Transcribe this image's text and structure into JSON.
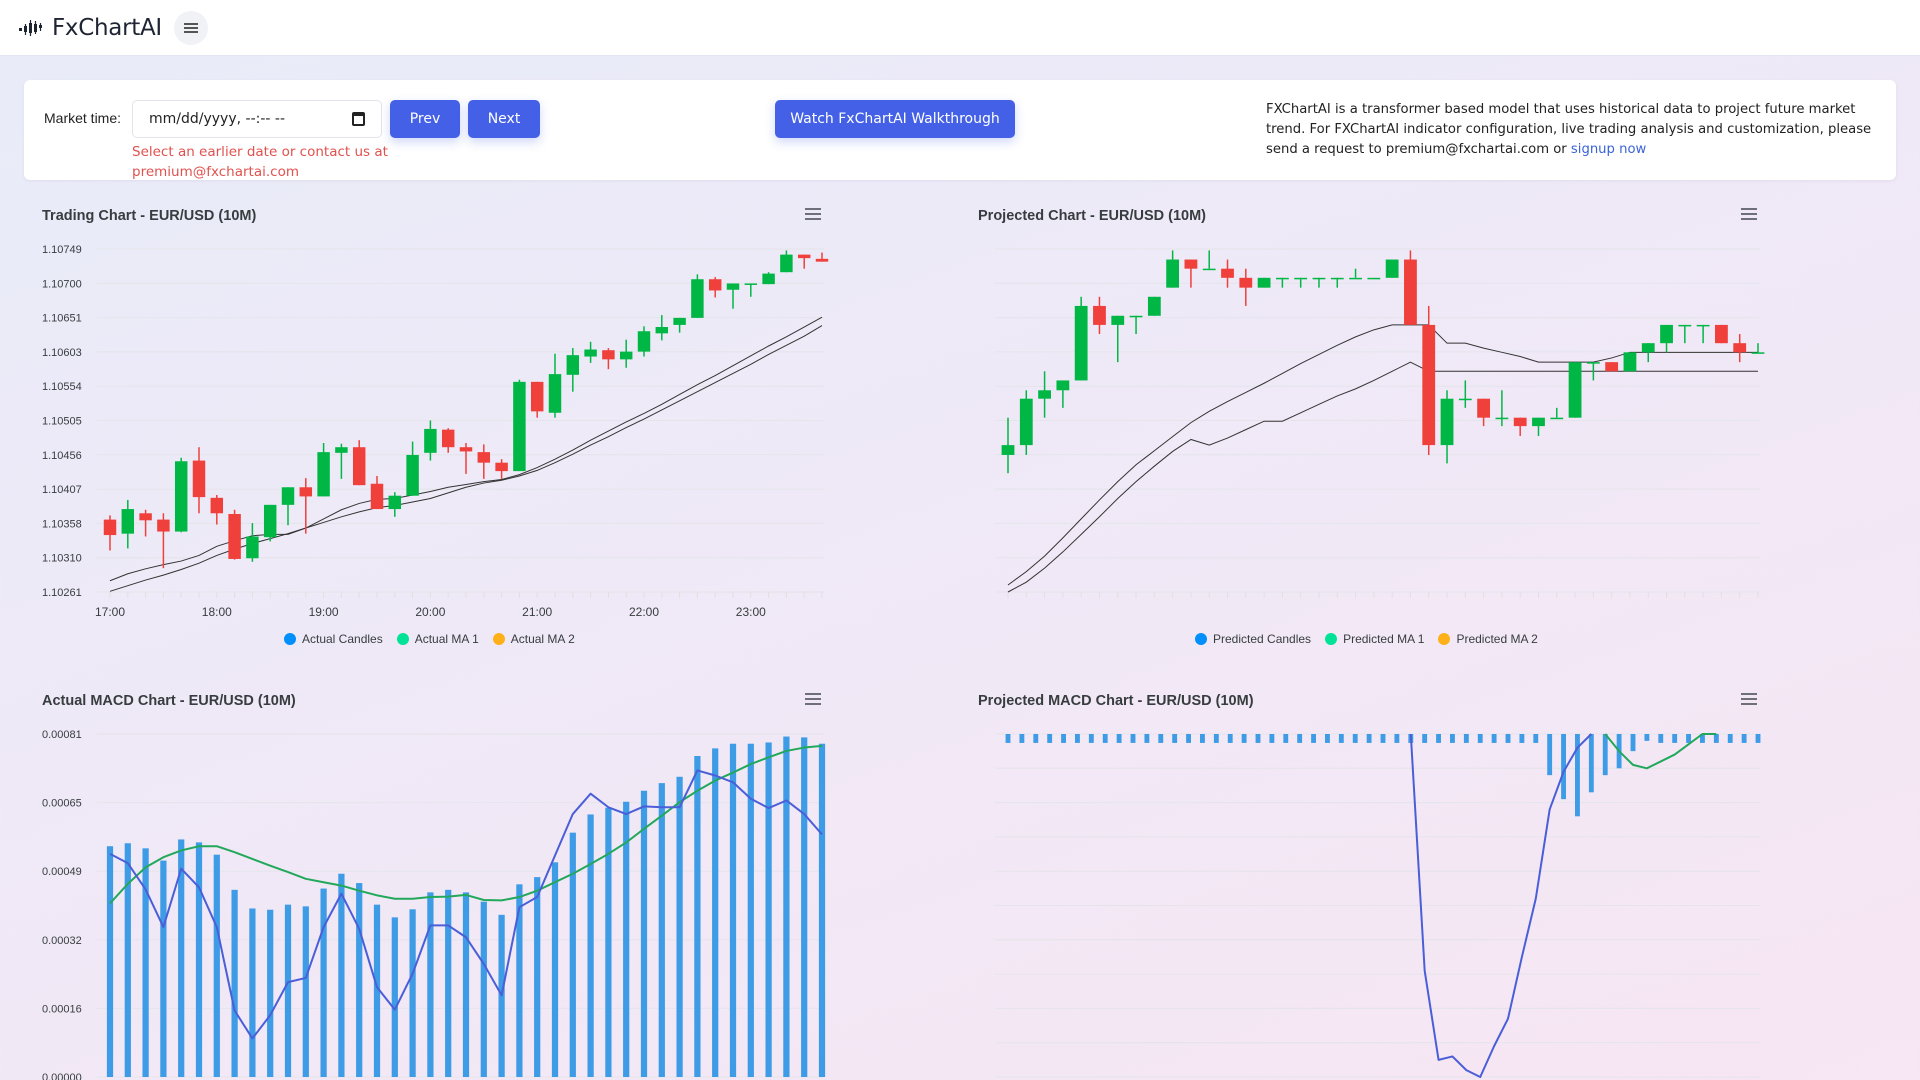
{
  "header": {
    "brand_name": "FxChartAI",
    "logo_icon": "candlestick-logo-icon",
    "menu_icon": "hamburger-menu-icon"
  },
  "controls": {
    "market_time_label": "Market time:",
    "market_time_value": "",
    "market_time_placeholder": "mm/dd/yyyy, --:-- --",
    "calendar_icon": "calendar-icon",
    "prev_label": "Prev",
    "next_label": "Next",
    "warning_line1": "Select an earlier date or contact us at",
    "warning_line2": "premium@fxchartai.com",
    "walkthrough_label": "Watch FxChartAI Walkthrough",
    "about_text": "FXChartAI is a transformer based model that uses historical data to project future market trend. For FXChartAI indicator configuration, live trading analysis and customization, please send a request to premium@fxchartai.com or ",
    "signup_link": "signup now"
  },
  "colors": {
    "accent": "#4460e6",
    "bull": "#00b746",
    "bear": "#ef403c",
    "macd_bar": "#3e9be6",
    "macd_line": "#4a5ed8",
    "signal_line": "#22a85a",
    "ma_line": "#333333",
    "warning": "#e0524f",
    "legend_candles": "#008ffb",
    "legend_ma1": "#00e396",
    "legend_ma2": "#feb019"
  },
  "chart_data": [
    {
      "id": "trading",
      "type": "candlestick",
      "title": "Trading Chart - EUR/USD (10M)",
      "menu_icon": "chart-menu-icon",
      "ylim": [
        1.10261,
        1.10749
      ],
      "yticks": [
        "1.10749",
        "1.10700",
        "1.10651",
        "1.10603",
        "1.10554",
        "1.10505",
        "1.10456",
        "1.10407",
        "1.10358",
        "1.10310",
        "1.10261"
      ],
      "xticks": [
        "17:00",
        "18:00",
        "19:00",
        "20:00",
        "21:00",
        "22:00",
        "23:00"
      ],
      "x_start": "17:00",
      "interval_minutes": 10,
      "legend": [
        "Actual Candles",
        "Actual MA 1",
        "Actual MA 2"
      ],
      "legend_position": "bottom-center",
      "grid": true,
      "candles": [
        [
          1.10364,
          1.1037,
          1.1032,
          1.10342
        ],
        [
          1.10344,
          1.10392,
          1.10323,
          1.10379
        ],
        [
          1.10373,
          1.10378,
          1.1034,
          1.10363
        ],
        [
          1.10364,
          1.10373,
          1.10295,
          1.10347
        ],
        [
          1.10347,
          1.10452,
          1.10346,
          1.10447
        ],
        [
          1.10448,
          1.10467,
          1.10373,
          1.10396
        ],
        [
          1.10395,
          1.10399,
          1.10357,
          1.10373
        ],
        [
          1.10372,
          1.10378,
          1.10307,
          1.10308
        ],
        [
          1.10309,
          1.10359,
          1.10304,
          1.1034
        ],
        [
          1.10339,
          1.10385,
          1.10333,
          1.10385
        ],
        [
          1.10385,
          1.1041,
          1.10356,
          1.1041
        ],
        [
          1.1041,
          1.10423,
          1.10344,
          1.10397
        ],
        [
          1.10397,
          1.10473,
          1.10397,
          1.1046
        ],
        [
          1.10459,
          1.10472,
          1.10422,
          1.10467
        ],
        [
          1.10467,
          1.10477,
          1.10413,
          1.10413
        ],
        [
          1.10415,
          1.10426,
          1.10379,
          1.10379
        ],
        [
          1.10379,
          1.10403,
          1.10368,
          1.10398
        ],
        [
          1.10398,
          1.10475,
          1.10398,
          1.10456
        ],
        [
          1.10459,
          1.10505,
          1.10448,
          1.10493
        ],
        [
          1.10492,
          1.10494,
          1.10459,
          1.10467
        ],
        [
          1.10467,
          1.10473,
          1.10429,
          1.10461
        ],
        [
          1.1046,
          1.10471,
          1.10422,
          1.10445
        ],
        [
          1.10445,
          1.1045,
          1.10422,
          1.10433
        ],
        [
          1.10433,
          1.10563,
          1.10433,
          1.1056
        ],
        [
          1.1056,
          1.1056,
          1.10509,
          1.10518
        ],
        [
          1.10516,
          1.106,
          1.10509,
          1.10571
        ],
        [
          1.1057,
          1.10608,
          1.10546,
          1.10598
        ],
        [
          1.10596,
          1.10617,
          1.10587,
          1.10606
        ],
        [
          1.10605,
          1.10608,
          1.10578,
          1.10592
        ],
        [
          1.10592,
          1.1062,
          1.1058,
          1.10603
        ],
        [
          1.10603,
          1.10639,
          1.10596,
          1.10632
        ],
        [
          1.10629,
          1.10655,
          1.10619,
          1.10638
        ],
        [
          1.10641,
          1.10651,
          1.1063,
          1.10651
        ],
        [
          1.10651,
          1.10713,
          1.10651,
          1.10706
        ],
        [
          1.10706,
          1.10709,
          1.1068,
          1.1069
        ],
        [
          1.10691,
          1.107,
          1.10664,
          1.107
        ],
        [
          1.10699,
          1.107,
          1.10681,
          1.107
        ],
        [
          1.10699,
          1.10716,
          1.10699,
          1.10714
        ],
        [
          1.10716,
          1.10747,
          1.10716,
          1.10741
        ],
        [
          1.10741,
          1.10741,
          1.10721,
          1.10736
        ],
        [
          1.10735,
          1.10744,
          1.10731,
          1.10731
        ]
      ],
      "ma1": [
        1.10277,
        1.10287,
        1.10294,
        1.103,
        1.10305,
        1.10313,
        1.10326,
        1.10334,
        1.10341,
        1.10343,
        1.10343,
        1.10352,
        1.10365,
        1.10378,
        1.10387,
        1.10393,
        1.10394,
        1.10399,
        1.10404,
        1.1041,
        1.10414,
        1.10418,
        1.10421,
        1.10428,
        1.10438,
        1.1045,
        1.10463,
        1.10477,
        1.1049,
        1.10503,
        1.10515,
        1.10528,
        1.10542,
        1.10556,
        1.10569,
        1.10583,
        1.10597,
        1.10611,
        1.10624,
        1.10638,
        1.10652
      ],
      "ma2": [
        1.10262,
        1.1027,
        1.10278,
        1.10285,
        1.10293,
        1.10302,
        1.10313,
        1.10322,
        1.1033,
        1.10337,
        1.10344,
        1.10352,
        1.1036,
        1.10368,
        1.10375,
        1.10381,
        1.10384,
        1.10389,
        1.10394,
        1.10402,
        1.1041,
        1.10416,
        1.1042,
        1.10426,
        1.10434,
        1.10445,
        1.10457,
        1.1047,
        1.10482,
        1.10495,
        1.10507,
        1.1052,
        1.10533,
        1.10546,
        1.10559,
        1.10572,
        1.10585,
        1.10599,
        1.10612,
        1.10625,
        1.1064
      ]
    },
    {
      "id": "projected",
      "type": "candlestick",
      "title": "Projected Chart - EUR/USD (10M)",
      "menu_icon": "chart-menu-icon",
      "ylim": [
        1.10261,
        1.10749
      ],
      "yticks": [],
      "xticks": [],
      "legend": [
        "Predicted Candles",
        "Predicted MA 1",
        "Predicted MA 2"
      ],
      "legend_position": "bottom-center",
      "grid": true,
      "candles": [
        [
          1.10456,
          1.10509,
          1.1043,
          1.1047
        ],
        [
          1.1047,
          1.10548,
          1.10456,
          1.10536
        ],
        [
          1.10536,
          1.10575,
          1.10509,
          1.10548
        ],
        [
          1.10548,
          1.10562,
          1.10523,
          1.10562
        ],
        [
          1.10562,
          1.10681,
          1.10562,
          1.10668
        ],
        [
          1.10668,
          1.10681,
          1.10628,
          1.10641
        ],
        [
          1.10641,
          1.10654,
          1.10588,
          1.10654
        ],
        [
          1.10654,
          1.10654,
          1.10628,
          1.10654
        ],
        [
          1.10654,
          1.10681,
          1.10654,
          1.10681
        ],
        [
          1.10694,
          1.10747,
          1.10694,
          1.10734
        ],
        [
          1.10734,
          1.10734,
          1.10694,
          1.10721
        ],
        [
          1.10721,
          1.10747,
          1.10721,
          1.10721
        ],
        [
          1.10721,
          1.10734,
          1.10694,
          1.10708
        ],
        [
          1.10708,
          1.10721,
          1.10668,
          1.10694
        ],
        [
          1.10694,
          1.10708,
          1.10694,
          1.10708
        ],
        [
          1.10708,
          1.10708,
          1.10694,
          1.10708
        ],
        [
          1.10708,
          1.10708,
          1.10694,
          1.10708
        ],
        [
          1.10708,
          1.10708,
          1.10694,
          1.10708
        ],
        [
          1.10708,
          1.10708,
          1.10694,
          1.10708
        ],
        [
          1.10708,
          1.10721,
          1.10708,
          1.10708
        ],
        [
          1.10708,
          1.10708,
          1.10708,
          1.10708
        ],
        [
          1.10708,
          1.10734,
          1.10708,
          1.10734
        ],
        [
          1.10734,
          1.10747,
          1.10641,
          1.10641
        ],
        [
          1.10641,
          1.10668,
          1.10456,
          1.1047
        ],
        [
          1.1047,
          1.10548,
          1.10444,
          1.10536
        ],
        [
          1.10536,
          1.10562,
          1.10523,
          1.10536
        ],
        [
          1.10536,
          1.10536,
          1.10497,
          1.10509
        ],
        [
          1.10509,
          1.10548,
          1.10497,
          1.10509
        ],
        [
          1.10509,
          1.10509,
          1.10483,
          1.10497
        ],
        [
          1.10497,
          1.10509,
          1.10483,
          1.10509
        ],
        [
          1.10509,
          1.10523,
          1.10509,
          1.10509
        ],
        [
          1.10509,
          1.10588,
          1.10509,
          1.10588
        ],
        [
          1.10588,
          1.10588,
          1.10562,
          1.10588
        ],
        [
          1.10588,
          1.10588,
          1.10575,
          1.10575
        ],
        [
          1.10575,
          1.10602,
          1.10575,
          1.10602
        ],
        [
          1.10602,
          1.10615,
          1.10588,
          1.10615
        ],
        [
          1.10615,
          1.10641,
          1.10602,
          1.10641
        ],
        [
          1.10641,
          1.10641,
          1.10615,
          1.10641
        ],
        [
          1.10641,
          1.10641,
          1.10615,
          1.10641
        ],
        [
          1.10641,
          1.10641,
          1.10615,
          1.10615
        ],
        [
          1.10615,
          1.10628,
          1.10588,
          1.10602
        ],
        [
          1.10602,
          1.10615,
          1.10602,
          1.10602
        ]
      ],
      "ma1": [
        1.10271,
        1.1029,
        1.10312,
        1.10338,
        1.10365,
        1.10392,
        1.10418,
        1.10442,
        1.10462,
        1.10482,
        1.10502,
        1.10518,
        1.10532,
        1.10545,
        1.10558,
        1.10572,
        1.10586,
        1.10599,
        1.10612,
        1.10624,
        1.10634,
        1.10641,
        1.10641,
        1.10641,
        1.10615,
        1.10615,
        1.10608,
        1.10602,
        1.10596,
        1.10588,
        1.10588,
        1.10588,
        1.10588,
        1.10594,
        1.10602,
        1.10602,
        1.10602,
        1.10602,
        1.10602,
        1.10602,
        1.10602,
        1.10602
      ],
      "ma2": [
        1.10261,
        1.10275,
        1.10295,
        1.10318,
        1.10343,
        1.10368,
        1.10394,
        1.10418,
        1.1044,
        1.10461,
        1.10478,
        1.1047,
        1.1048,
        1.10492,
        1.10504,
        1.10504,
        1.10516,
        1.10528,
        1.1054,
        1.1055,
        1.10562,
        1.10575,
        1.10588,
        1.10575,
        1.10575,
        1.10575,
        1.10575,
        1.10575,
        1.10575,
        1.10575,
        1.10575,
        1.10575,
        1.10575,
        1.10575,
        1.10575,
        1.10575,
        1.10575,
        1.10575,
        1.10575,
        1.10575,
        1.10575,
        1.10575
      ]
    },
    {
      "id": "actual_macd",
      "type": "bar+line",
      "title": "Actual MACD Chart - EUR/USD (10M)",
      "menu_icon": "chart-menu-icon",
      "ylim": [
        0,
        0.00081
      ],
      "yticks": [
        "0.00081",
        "0.00065",
        "0.00049",
        "0.00032",
        "0.00016",
        "0.00000"
      ],
      "grid": true,
      "histogram": [
        0.000545,
        0.000552,
        0.00054,
        0.000511,
        0.000561,
        0.000554,
        0.000525,
        0.000442,
        0.000398,
        0.000395,
        0.000407,
        0.000403,
        0.000445,
        0.00048,
        0.000458,
        0.000407,
        0.000377,
        0.000396,
        0.000436,
        0.000442,
        0.000436,
        0.000414,
        0.000383,
        0.000455,
        0.000472,
        0.000507,
        0.000577,
        0.00062,
        0.000636,
        0.00065,
        0.000676,
        0.000694,
        0.000709,
        0.000758,
        0.000776,
        0.000787,
        0.000787,
        0.00079,
        0.000804,
        0.000802,
        0.000787
      ],
      "macd": [
        0.000527,
        0.000505,
        0.000443,
        0.000354,
        0.000492,
        0.000448,
        0.000354,
        0.000157,
        9.1e-05,
        0.000146,
        0.000224,
        0.000234,
        0.000354,
        0.000433,
        0.00035,
        0.000212,
        0.000159,
        0.000244,
        0.000358,
        0.000358,
        0.00033,
        0.000267,
        0.000193,
        0.000401,
        0.000425,
        0.000523,
        0.000621,
        0.000669,
        0.000637,
        0.000621,
        0.000639,
        0.000637,
        0.000637,
        0.000724,
        0.000712,
        0.000696,
        0.000657,
        0.000635,
        0.000653,
        0.000621,
        0.000573
      ],
      "signal": [
        0.00041,
        0.000456,
        0.000495,
        0.000519,
        0.000535,
        0.000545,
        0.000545,
        0.000531,
        0.000515,
        0.000499,
        0.000484,
        0.000468,
        0.00046,
        0.000452,
        0.00044,
        0.000429,
        0.000421,
        0.000421,
        0.000425,
        0.000426,
        0.00043,
        0.000418,
        0.000417,
        0.000425,
        0.00044,
        0.00046,
        0.00048,
        0.000503,
        0.000527,
        0.000554,
        0.000586,
        0.000617,
        0.000649,
        0.000676,
        0.0007,
        0.000719,
        0.000739,
        0.000755,
        0.00077,
        0.000778,
        0.000782
      ]
    },
    {
      "id": "projected_macd",
      "type": "bar+line",
      "title": "Projected MACD Chart - EUR/USD (10M)",
      "menu_icon": "chart-menu-icon",
      "units": "relative (gridline units, unlabeled axis)",
      "ylim": [
        -10,
        0
      ],
      "yticks": [],
      "grid": true,
      "histogram": [
        -0.26,
        -0.26,
        -0.26,
        -0.26,
        -0.26,
        -0.26,
        -0.26,
        -0.26,
        -0.26,
        -0.26,
        -0.26,
        -0.26,
        -0.26,
        -0.26,
        -0.26,
        -0.26,
        -0.26,
        -0.26,
        -0.26,
        -0.26,
        -0.26,
        -0.26,
        -0.26,
        -0.26,
        -0.26,
        -0.26,
        -0.26,
        -0.26,
        -0.26,
        -0.26,
        -0.26,
        -0.26,
        -0.26,
        -0.26,
        -0.26,
        -0.26,
        -0.26,
        -0.26,
        -0.26,
        -1.2,
        -1.9,
        -2.4,
        -1.7,
        -1.2,
        -1.0,
        -0.5,
        -0.2,
        -0.26,
        -0.26,
        -0.26,
        -0.26,
        -0.26,
        -0.26,
        -0.26,
        -0.26
      ],
      "macd": [
        null,
        null,
        null,
        null,
        null,
        null,
        null,
        null,
        null,
        null,
        null,
        null,
        null,
        null,
        null,
        null,
        null,
        null,
        null,
        null,
        null,
        null,
        null,
        null,
        null,
        null,
        null,
        null,
        null,
        0.5,
        -6.9,
        -9.5,
        -9.4,
        -9.8,
        -10.0,
        -9.1,
        -8.3,
        -6.5,
        -4.8,
        -2.2,
        -1.1,
        -0.4,
        0.5,
        null,
        null,
        null,
        null,
        null,
        null,
        null,
        null,
        null,
        null,
        null,
        null
      ],
      "signal": [
        null,
        null,
        null,
        null,
        null,
        null,
        null,
        null,
        null,
        null,
        null,
        null,
        null,
        null,
        null,
        null,
        null,
        null,
        null,
        null,
        null,
        null,
        null,
        null,
        null,
        null,
        null,
        null,
        null,
        null,
        null,
        null,
        null,
        null,
        null,
        null,
        null,
        null,
        null,
        null,
        null,
        null,
        null,
        0.2,
        -0.5,
        -0.9,
        -1.0,
        -0.8,
        -0.6,
        -0.3,
        0.0,
        0.1,
        null,
        null,
        null
      ]
    }
  ]
}
